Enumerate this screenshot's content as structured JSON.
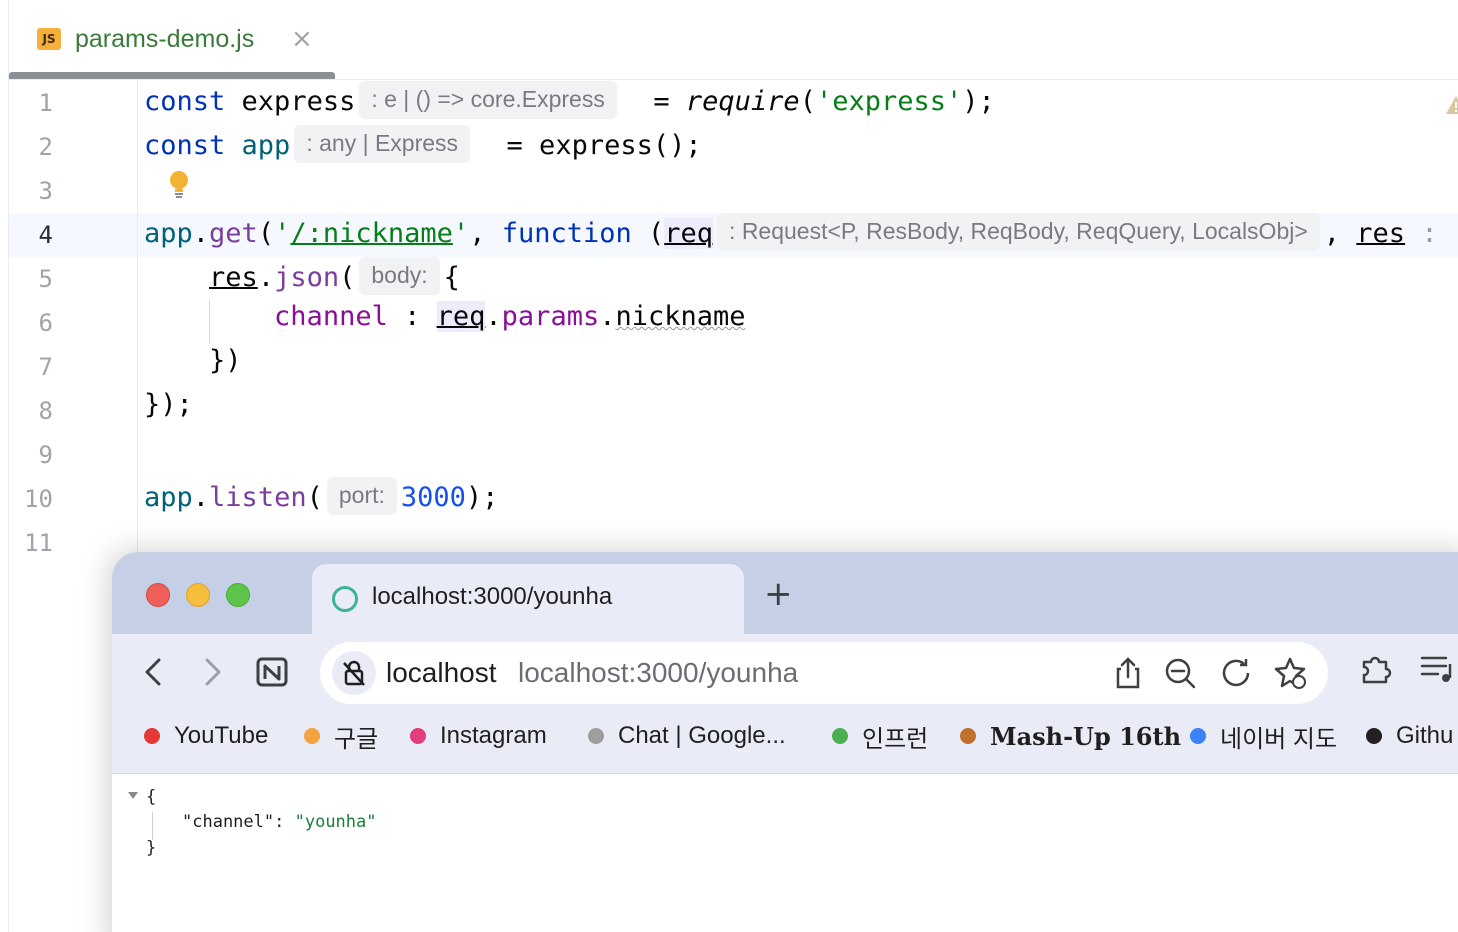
{
  "editor": {
    "tab": {
      "icon_label": "JS",
      "name": "params-demo.js",
      "close": "×"
    },
    "line_numbers": [
      "1",
      "2",
      "3",
      "4",
      "5",
      "6",
      "7",
      "8",
      "9",
      "10",
      "11"
    ],
    "active_line": "4",
    "code": {
      "l1": {
        "kw": "const",
        "name": "express",
        "hint": ": e | () => core.Express",
        "eq": "= ",
        "req": "require",
        "open": "(",
        "arg": "'express'",
        "close": ");"
      },
      "l2": {
        "kw": "const",
        "name": "app",
        "hint": ": any | Express",
        "rest": "= express();"
      },
      "l4": {
        "obj": "app",
        "dot": ".",
        "meth": "get",
        "open": "(",
        "q1": "'",
        "route": "/:nickname",
        "q2": "'",
        "comma": ", ",
        "kw": "function",
        "paren": " (",
        "p1": "req",
        "hint": ": Request<P, ResBody, ReqBody, ReqQuery, LocalsObj>",
        "comma2": ", ",
        "p2": "res",
        "tail": ":"
      },
      "l5": {
        "obj": "res",
        "dot": ".",
        "meth": "json",
        "open": "(",
        "hint": "body:",
        "brace": "{"
      },
      "l6": {
        "key": "channel",
        "colon": " : ",
        "obj": "req",
        "dot1": ".",
        "prop": "params",
        "dot2": ".",
        "field": "nickname"
      },
      "l7": "})",
      "l8": "});",
      "l10": {
        "obj": "app",
        "dot": ".",
        "meth": "listen",
        "open": "(",
        "hint": "port:",
        "num": "3000",
        "close": ");"
      }
    }
  },
  "browser": {
    "tab_title": "localhost:3000/younha",
    "new_tab": "+",
    "omnibox": {
      "host": "localhost",
      "url": "localhost:3000/younha"
    },
    "bookmarks": [
      {
        "label": "YouTube",
        "color": "#e53935"
      },
      {
        "label": "구글",
        "color": "#f4a340"
      },
      {
        "label": "Instagram",
        "color": "#e23d7d"
      },
      {
        "label": "Chat | Google...",
        "color": "#9e9e9e"
      },
      {
        "label": "인프런",
        "color": "#4caf50"
      },
      {
        "label": "Mash-Up 16th",
        "color": "#c0712b"
      },
      {
        "label": "네이버 지도",
        "color": "#3b82f6"
      },
      {
        "label": "Githu",
        "color": "#222222"
      }
    ],
    "json_view": {
      "open": "{",
      "key": "\"channel\"",
      "colon": ": ",
      "value": "\"younha\"",
      "close": "}"
    }
  }
}
